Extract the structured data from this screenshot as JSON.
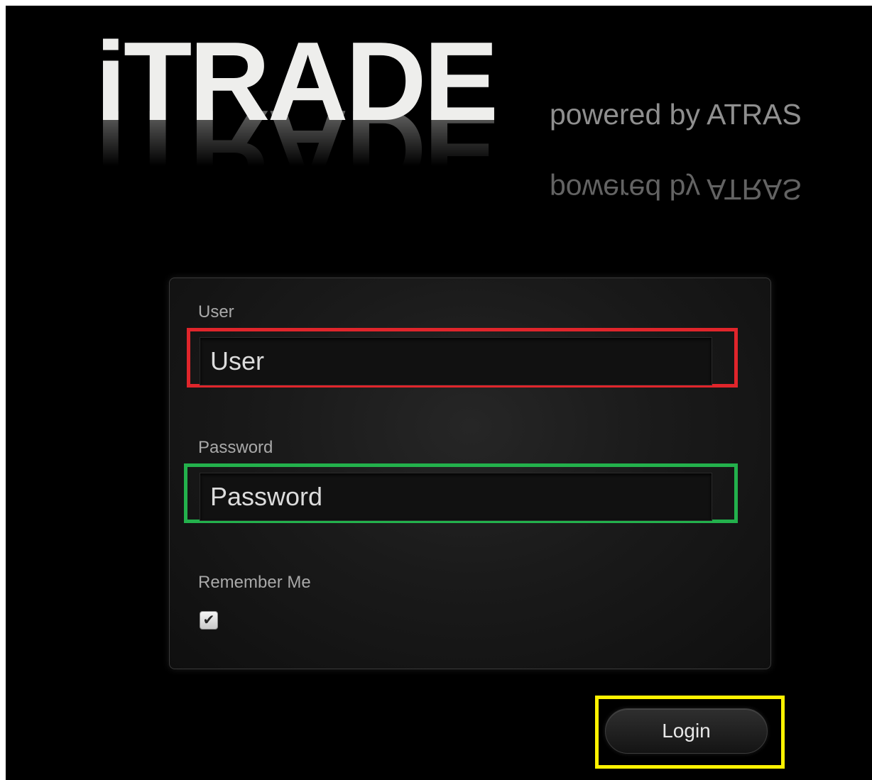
{
  "app": {
    "logo_text": "iTRADE",
    "logo_subtitle": "powered by ATRAS"
  },
  "form": {
    "user_label": "User",
    "user_placeholder": "User",
    "user_value": "",
    "password_label": "Password",
    "password_placeholder": "Password",
    "password_value": "",
    "remember_label": "Remember Me",
    "remember_checked": true,
    "checkmark_glyph": "✔",
    "login_label": "Login"
  },
  "highlights": {
    "user_field_color": "#e0252b",
    "password_field_color": "#23b14c",
    "login_button_color": "#fff200"
  }
}
